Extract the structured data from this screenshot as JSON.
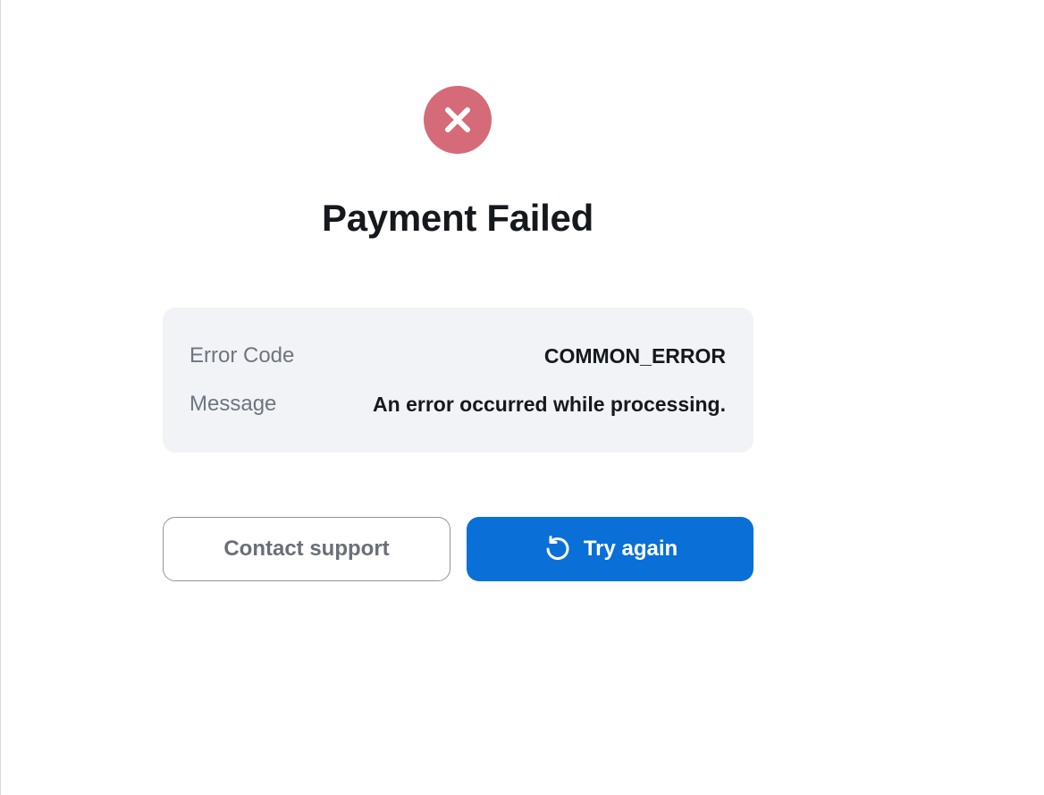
{
  "status": {
    "icon": "error-x-icon",
    "color": "#d56b78",
    "title": "Payment Failed"
  },
  "details": {
    "error_code_label": "Error Code",
    "error_code_value": "COMMON_ERROR",
    "message_label": "Message",
    "message_value": "An error occurred while processing."
  },
  "actions": {
    "contact_label": "Contact support",
    "retry_label": "Try again",
    "retry_icon": "refresh-icon",
    "primary_color": "#0a6fd6"
  }
}
